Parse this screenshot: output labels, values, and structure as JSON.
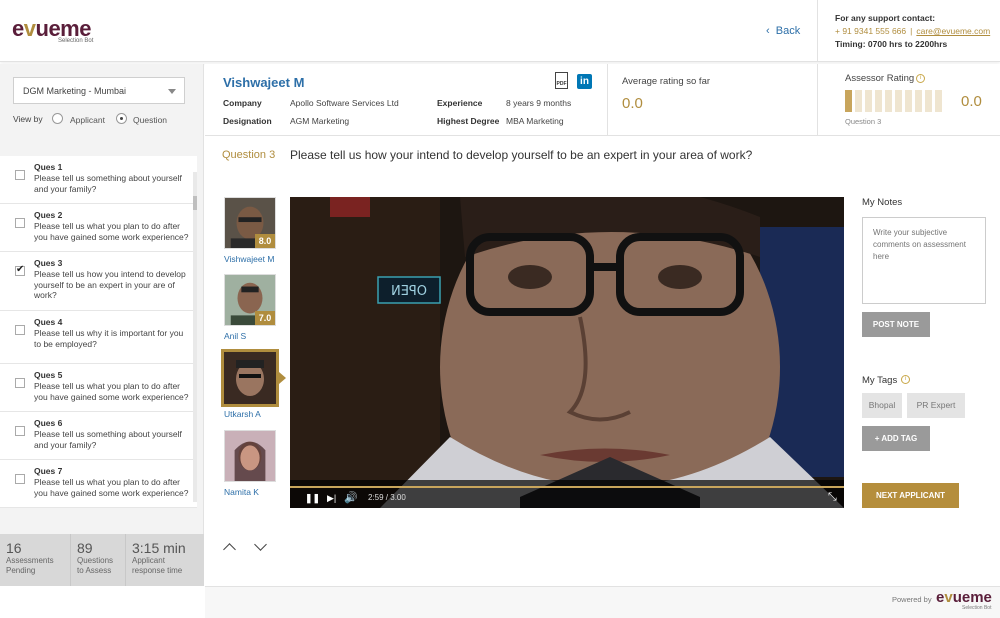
{
  "header": {
    "logo_main": "evueme",
    "logo_prefix": "e",
    "logo_accent": "v",
    "logo_rest": "ueme",
    "logo_sub": "Selection Bot",
    "back_label": "Back",
    "support": {
      "title": "For any support contact:",
      "phone": "+ 91 9341 555 666",
      "email": "care@evueme.com",
      "timing": "Timing: 0700 hrs to  2200hrs"
    }
  },
  "sidebar": {
    "role_select": "DGM Marketing - Mumbai",
    "view_by_label": "View by",
    "view_options": [
      "Applicant",
      "Question"
    ],
    "view_selected": "Question",
    "questions": [
      {
        "title": "Ques 1",
        "text": "Please tell us something about yourself and your family?",
        "checked": false
      },
      {
        "title": "Ques 2",
        "text": "Please tell us what you plan to do after you have gained some work experience?",
        "checked": false
      },
      {
        "title": "Ques 3",
        "text": "Please tell us how you intend to develop yourself to be an expert in your are of work?",
        "checked": true
      },
      {
        "title": "Ques 4",
        "text": "Please tell us why it is important for you to be employed?",
        "checked": false
      },
      {
        "title": "Ques 5",
        "text": "Please tell us what you plan to do after you have gained some work experience?",
        "checked": false
      },
      {
        "title": "Ques 6",
        "text": "Please tell us something about yourself and your family?",
        "checked": false
      },
      {
        "title": "Ques 7",
        "text": "Please tell us what you plan to do after you have gained some work experience?",
        "checked": false
      }
    ],
    "stats": [
      {
        "value": "16",
        "label1": "Assessments",
        "label2": "Pending"
      },
      {
        "value": "89",
        "label1": "Questions",
        "label2": "to Assess"
      },
      {
        "value": "3:15 min",
        "label1": "Applicant",
        "label2": "response time"
      }
    ]
  },
  "candidate": {
    "name": "Vishwajeet M",
    "company_label": "Company",
    "company": "Apollo Software Services Ltd",
    "designation_label": "Designation",
    "designation": "AGM Marketing",
    "experience_label": "Experience",
    "experience": "8 years 9 months",
    "degree_label": "Highest Degree",
    "degree": "MBA Marketing",
    "pdf_icon_text": "PDF",
    "linkedin_icon_text": "in",
    "avg_rating_label": "Average rating so far",
    "avg_rating": "0.0",
    "assessor_rating_label": "Assessor Rating",
    "assessor_rating": "0.0",
    "assessor_rating_sub": "Question 3",
    "rating_scale_steps": 10,
    "rating_filled": 1,
    "accent_color": "#b08d3e"
  },
  "question": {
    "number": "Question 3",
    "text": "Please tell us how your intend to develop yourself to be an expert in your area of work?"
  },
  "applicants": [
    {
      "name": "Vishwajeet M",
      "score": "8.0",
      "selected": false
    },
    {
      "name": "Anil S",
      "score": "7.0",
      "selected": false
    },
    {
      "name": "Utkarsh A",
      "score": "",
      "selected": true
    },
    {
      "name": "Namita K",
      "score": "",
      "selected": false
    }
  ],
  "video": {
    "time": "2:59 / 3.00",
    "sign_text": "OPEN"
  },
  "notes": {
    "label": "My Notes",
    "placeholder": "Write your subjective comments on assessment here",
    "post_label": "POST NOTE"
  },
  "tags": {
    "label": "My Tags",
    "items": [
      "Bhopal",
      "PR Expert"
    ],
    "add_label": "+ ADD TAG"
  },
  "next_label": "NEXT APPLICANT",
  "footer": {
    "powered": "Powered by",
    "logo": "evueme",
    "logo_prefix": "e",
    "logo_accent": "v",
    "logo_rest": "ueme",
    "logo_sub": "Selection Bot"
  }
}
